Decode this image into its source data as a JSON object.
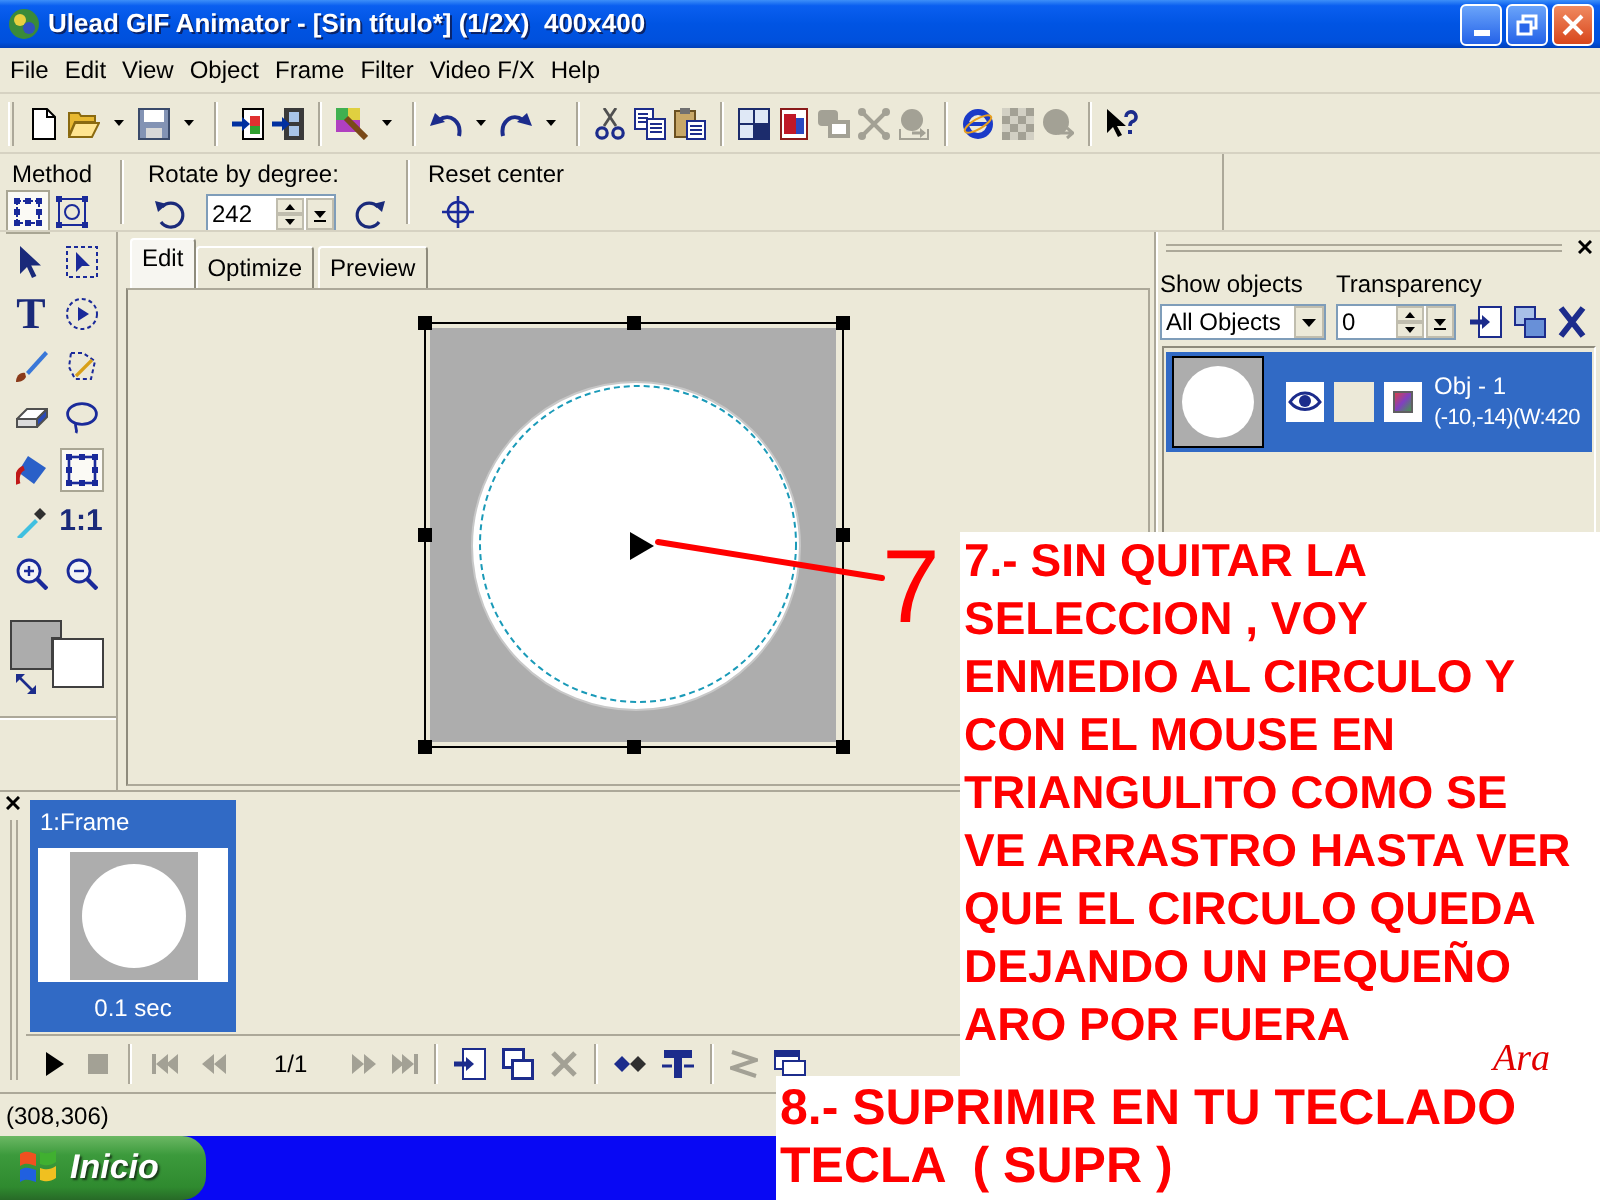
{
  "window": {
    "title": "Ulead GIF Animator - [Sin título*] (1/2X)  400x400"
  },
  "menu": [
    "File",
    "Edit",
    "View",
    "Object",
    "Frame",
    "Filter",
    "Video F/X",
    "Help"
  ],
  "toolbar": [
    [
      {
        "kind": "new",
        "disabled": false,
        "menu": false
      },
      {
        "kind": "open",
        "disabled": false,
        "menu": true
      },
      {
        "kind": "save",
        "disabled": false,
        "menu": true
      }
    ],
    [
      {
        "kind": "import",
        "disabled": false,
        "menu": false
      },
      {
        "kind": "film",
        "disabled": false,
        "menu": false
      }
    ],
    [
      {
        "kind": "color",
        "disabled": false,
        "menu": true
      }
    ],
    [
      {
        "kind": "undo",
        "disabled": false,
        "menu": true
      },
      {
        "kind": "redo",
        "disabled": false,
        "menu": true
      }
    ],
    [
      {
        "kind": "cut",
        "disabled": false,
        "menu": false
      },
      {
        "kind": "copy",
        "disabled": false,
        "menu": false
      },
      {
        "kind": "paste",
        "disabled": false,
        "menu": false
      }
    ],
    [
      {
        "kind": "crop",
        "disabled": false,
        "menu": false
      },
      {
        "kind": "page",
        "disabled": false,
        "menu": false
      },
      {
        "kind": "layers",
        "disabled": true,
        "menu": false
      },
      {
        "kind": "cross",
        "disabled": true,
        "menu": false
      },
      {
        "kind": "export",
        "disabled": true,
        "menu": false
      }
    ],
    [
      {
        "kind": "browser",
        "disabled": false,
        "menu": false
      },
      {
        "kind": "checker",
        "disabled": true,
        "menu": false
      },
      {
        "kind": "ball",
        "disabled": true,
        "menu": false
      }
    ],
    [
      {
        "kind": "help",
        "disabled": false,
        "menu": false
      }
    ]
  ],
  "attributes": {
    "method_label": "Method",
    "methods": [
      {
        "kind": "frame",
        "selected": true
      },
      {
        "kind": "rotate",
        "selected": false
      }
    ],
    "rotate_label": "Rotate by degree:",
    "rotate_value": "242",
    "reset_label": "Reset center"
  },
  "tools": [
    {
      "kind": "pointer",
      "selected": false
    },
    {
      "kind": "select",
      "selected": false
    },
    {
      "kind": "text",
      "label": "T",
      "selected": false
    },
    {
      "kind": "circle",
      "selected": false
    },
    {
      "kind": "brush",
      "selected": false
    },
    {
      "kind": "wand",
      "selected": false
    },
    {
      "kind": "eraser",
      "selected": false
    },
    {
      "kind": "lasso",
      "selected": false
    },
    {
      "kind": "bucket",
      "selected": false
    },
    {
      "kind": "transform",
      "selected": true
    },
    {
      "kind": "eyedropper",
      "selected": false
    },
    {
      "kind": "actual-size",
      "label": "1:1",
      "selected": false
    },
    {
      "kind": "zoom-in",
      "selected": false
    },
    {
      "kind": "zoom-out",
      "selected": false
    }
  ],
  "swatches": [
    {
      "color": "#acacac"
    },
    {
      "color": "#ffffff"
    }
  ],
  "tabs": [
    {
      "label": "Edit",
      "selected": true
    },
    {
      "label": "Optimize",
      "selected": false
    },
    {
      "label": "Preview",
      "selected": false
    }
  ],
  "annotation": {
    "number": "7"
  },
  "objects_panel": {
    "show_label": "Show objects",
    "show_value": "All Objects",
    "transparency_label": "Transparency",
    "transparency_value": "0",
    "objects": [
      {
        "name": "Obj - 1",
        "info": "(-10,-14)(W:420",
        "selected": true,
        "visible": true
      }
    ]
  },
  "frames": [
    {
      "label": "1:Frame",
      "delay": "0.1 sec",
      "selected": true
    }
  ],
  "playback": {
    "start": [
      [
        {
          "kind": "play",
          "disabled": false
        },
        {
          "kind": "stop",
          "disabled": true
        }
      ],
      [
        {
          "kind": "first",
          "disabled": true
        },
        {
          "kind": "previous",
          "disabled": true
        }
      ]
    ],
    "counter": "1/1",
    "end": [
      [
        {
          "kind": "next",
          "disabled": true
        },
        {
          "kind": "last",
          "disabled": true
        }
      ],
      [
        {
          "kind": "add",
          "disabled": false
        },
        {
          "kind": "duplicate",
          "disabled": false
        },
        {
          "kind": "delete",
          "disabled": true
        }
      ],
      [
        {
          "kind": "tween",
          "disabled": false
        },
        {
          "kind": "banner",
          "disabled": false
        }
      ],
      [
        {
          "kind": "reverse",
          "disabled": true
        },
        {
          "kind": "properties",
          "disabled": false
        }
      ]
    ]
  },
  "status_bar": "(308,306)",
  "taskbar": {
    "start_label": "Inicio"
  },
  "notes": [
    {
      "text": "7.- SIN QUITAR LA\nSELECCION , VOY\nENMEDIO AL CIRCULO Y\nCON EL MOUSE EN\nTRIANGULITO COMO SE\nVE ARRASTRO HASTA VER\nQUE EL CIRCULO QUEDA\nDEJANDO UN PEQUEÑO\nARO POR FUERA"
    },
    {
      "text": "8.- SUPRIMIR EN TU TECLADO\nTECLA  ( SUPR )"
    }
  ],
  "signature": "Ara"
}
